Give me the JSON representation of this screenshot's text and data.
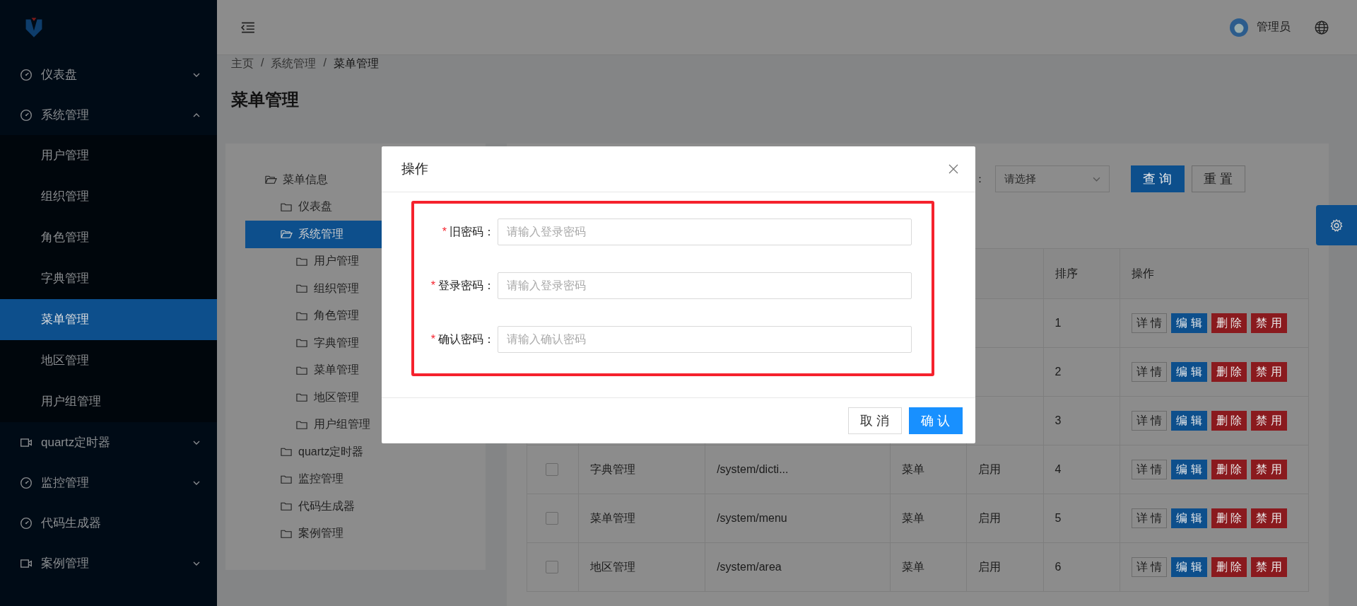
{
  "sidebar": {
    "items": [
      {
        "label": "仪表盘",
        "kind": "submenu",
        "expanded": false,
        "selected": false
      },
      {
        "label": "系统管理",
        "kind": "submenu",
        "expanded": true,
        "selected": false,
        "children": [
          {
            "label": "用户管理",
            "selected": false
          },
          {
            "label": "组织管理",
            "selected": false
          },
          {
            "label": "角色管理",
            "selected": false
          },
          {
            "label": "字典管理",
            "selected": false
          },
          {
            "label": "菜单管理",
            "selected": true
          },
          {
            "label": "地区管理",
            "selected": false
          },
          {
            "label": "用户组管理",
            "selected": false
          }
        ]
      },
      {
        "label": "quartz定时器",
        "kind": "submenu",
        "expanded": false,
        "selected": false
      },
      {
        "label": "监控管理",
        "kind": "submenu",
        "expanded": false,
        "selected": false
      },
      {
        "label": "代码生成器",
        "kind": "item",
        "selected": false
      },
      {
        "label": "案例管理",
        "kind": "submenu",
        "expanded": false,
        "selected": false
      }
    ]
  },
  "header": {
    "user": "管理员"
  },
  "breadcrumb": {
    "separator": "/",
    "items": [
      "主页",
      "系统管理",
      "菜单管理"
    ]
  },
  "page_title": "菜单管理",
  "tree": [
    {
      "label": "菜单信息",
      "expanded": true,
      "selected": false,
      "children": [
        {
          "label": "仪表盘",
          "expanded": false,
          "selected": false
        },
        {
          "label": "系统管理",
          "expanded": true,
          "selected": true,
          "children": [
            {
              "label": "用户管理",
              "expanded": false,
              "selected": false
            },
            {
              "label": "组织管理",
              "expanded": false,
              "selected": false
            },
            {
              "label": "角色管理",
              "expanded": false,
              "selected": false
            },
            {
              "label": "字典管理",
              "expanded": false,
              "selected": false
            },
            {
              "label": "菜单管理",
              "expanded": false,
              "selected": false
            },
            {
              "label": "地区管理",
              "expanded": false,
              "selected": false
            },
            {
              "label": "用户组管理",
              "expanded": false,
              "selected": false
            }
          ]
        },
        {
          "label": "quartz定时器",
          "expanded": false,
          "selected": false
        },
        {
          "label": "监控管理",
          "expanded": false,
          "selected": false
        },
        {
          "label": "代码生成器",
          "expanded": false,
          "selected": false
        },
        {
          "label": "案例管理",
          "expanded": false,
          "selected": false
        }
      ]
    }
  ],
  "query": {
    "label": "：",
    "select_placeholder": "请选择",
    "buttons": [
      {
        "label": "查 询",
        "kind": "primary"
      },
      {
        "label": "重 置",
        "kind": "default"
      }
    ]
  },
  "table": {
    "columns": [
      "排序",
      "操作"
    ],
    "rows": [
      {
        "sort": "1",
        "actions": [
          {
            "label": "详 情",
            "kind": "default"
          },
          {
            "label": "编 辑",
            "kind": "primary"
          },
          {
            "label": "删 除",
            "kind": "danger"
          },
          {
            "label": "禁 用",
            "kind": "danger"
          }
        ]
      },
      {
        "sort": "2",
        "actions": [
          {
            "label": "详 情",
            "kind": "default"
          },
          {
            "label": "编 辑",
            "kind": "primary"
          },
          {
            "label": "删 除",
            "kind": "danger"
          },
          {
            "label": "禁 用",
            "kind": "danger"
          }
        ]
      },
      {
        "sort": "3",
        "actions": [
          {
            "label": "详 情",
            "kind": "default"
          },
          {
            "label": "编 辑",
            "kind": "primary"
          },
          {
            "label": "删 除",
            "kind": "danger"
          },
          {
            "label": "禁 用",
            "kind": "danger"
          }
        ]
      },
      {
        "checked": false,
        "name": "字典管理",
        "path": "/system/dicti...",
        "type": "菜单",
        "status": "启用",
        "sort": "4",
        "actions": [
          {
            "label": "详 情",
            "kind": "default"
          },
          {
            "label": "编 辑",
            "kind": "primary"
          },
          {
            "label": "删 除",
            "kind": "danger"
          },
          {
            "label": "禁 用",
            "kind": "danger"
          }
        ]
      },
      {
        "checked": false,
        "name": "菜单管理",
        "path": "/system/menu",
        "type": "菜单",
        "status": "启用",
        "sort": "5",
        "actions": [
          {
            "label": "详 情",
            "kind": "default"
          },
          {
            "label": "编 辑",
            "kind": "primary"
          },
          {
            "label": "删 除",
            "kind": "danger"
          },
          {
            "label": "禁 用",
            "kind": "danger"
          }
        ]
      },
      {
        "checked": false,
        "name": "地区管理",
        "path": "/system/area",
        "type": "菜单",
        "status": "启用",
        "sort": "6",
        "actions": [
          {
            "label": "详 情",
            "kind": "default"
          },
          {
            "label": "编 辑",
            "kind": "primary"
          },
          {
            "label": "删 除",
            "kind": "danger"
          },
          {
            "label": "禁 用",
            "kind": "danger"
          }
        ]
      }
    ]
  },
  "dialog": {
    "title": "操作",
    "fields": [
      {
        "label": "旧密码：",
        "required_mark": "*",
        "placeholder": "请输入登录密码"
      },
      {
        "label": "登录密码：",
        "required_mark": "*",
        "placeholder": "请输入登录密码"
      },
      {
        "label": "确认密码：",
        "required_mark": "*",
        "placeholder": "请输入确认密码"
      }
    ],
    "buttons": [
      {
        "label": "取 消",
        "kind": "default"
      },
      {
        "label": "确 认",
        "kind": "primary"
      }
    ]
  }
}
